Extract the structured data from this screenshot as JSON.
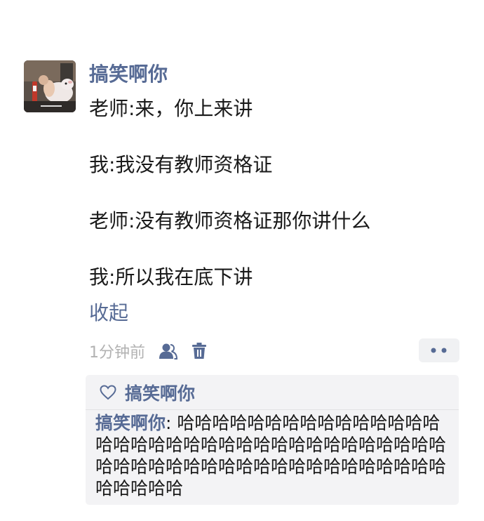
{
  "post": {
    "author": "搞笑啊你",
    "lines": [
      "老师:来，你上来讲",
      "我:我没有教师资格证",
      "老师:没有教师资格证那你讲什么",
      "我:所以我在底下讲"
    ],
    "collapse_label": "收起",
    "timestamp": "1分钟前",
    "accent_color": "#576b95"
  },
  "likes": {
    "users": [
      "搞笑啊你"
    ]
  },
  "comments": [
    {
      "author": "搞笑啊你",
      "separator": ": ",
      "text": "哈哈哈哈哈哈哈哈哈哈哈哈哈哈哈哈哈哈哈哈哈哈哈哈哈哈哈哈哈哈哈哈哈哈哈哈哈哈哈哈哈哈哈哈哈哈哈哈哈哈哈哈哈哈哈哈哈哈哈哈"
    }
  ],
  "icons": {
    "friends": "people-icon",
    "delete": "trash-icon",
    "more": "more-dots-icon",
    "like": "heart-icon"
  }
}
